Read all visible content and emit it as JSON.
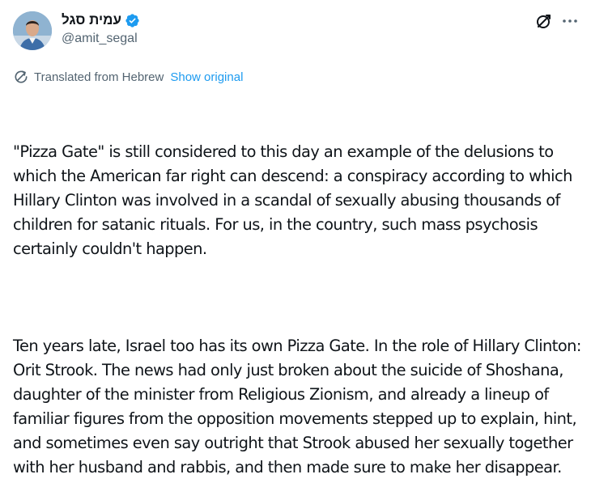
{
  "author": {
    "display_name": "עמית סגל",
    "handle": "@amit_segal",
    "verified": true
  },
  "icons": {
    "avatar": "avatar",
    "verified": "verified-badge-icon",
    "grok": "grok-icon",
    "more": "more-icon",
    "translate": "translate-icon"
  },
  "colors": {
    "text": "#0f1419",
    "secondary": "#536471",
    "link": "#1d9bf0"
  },
  "translation": {
    "label": "Translated from Hebrew",
    "show_original": "Show original"
  },
  "body": {
    "paragraph_1": "\"Pizza Gate\" is still considered to this day an example of the delusions to which the American far right can descend: a conspiracy according to which Hillary Clinton was involved in a scandal of sexually abusing thousands of children for satanic rituals. For us, in the country, such mass psychosis certainly couldn't happen.",
    "paragraph_2": "Ten years late, Israel too has its own Pizza Gate. In the role of Hillary Clinton: Orit Strook. The news had only just broken about the suicide of Shoshana, daughter of the minister from Religious Zionism, and already a lineup of familiar figures from the opposition movements stepped up to explain, hint, and sometimes even say outright that Strook abused her sexually together with her husband and rabbis, and then made sure to make her disappear."
  }
}
